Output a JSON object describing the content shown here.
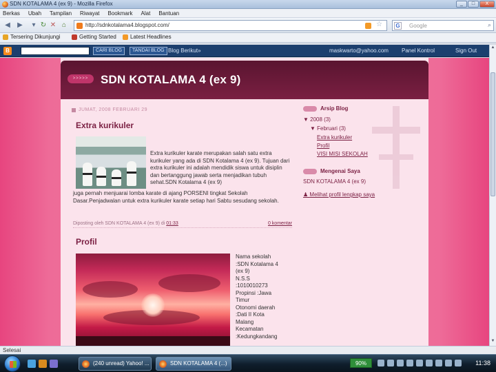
{
  "window": {
    "title": "SDN KOTALAMA 4 (ex 9) - Mozilla Firefox",
    "buttons": [
      "_",
      "□",
      "X"
    ]
  },
  "menu": [
    "Berkas",
    "Ubah",
    "Tampilan",
    "Riwayat",
    "Bookmark",
    "Alat",
    "Bantuan"
  ],
  "nav": {
    "url": "http://sdnkotalama4.blogspot.com/",
    "search_placeholder": "Google"
  },
  "bookmarks": [
    {
      "label": "Tersering Dikunjungi",
      "icon": "star-icon",
      "color": "#e7a526"
    },
    {
      "label": "Getting Started",
      "icon": "firefox-icon",
      "color": "#c0392b"
    },
    {
      "label": "Latest Headlines",
      "icon": "rss-icon",
      "color": "#f39a28"
    }
  ],
  "blogger_nav": {
    "search_button": "CARI BLOG",
    "flag_button": "TANDAI BLOG",
    "next_blog": "Blog Berikut»",
    "email": "maskwarto@yahoo.com",
    "dashboard": "Panel Kontrol",
    "signout": "Sign Out"
  },
  "blog": {
    "header_pill": ">>>>>",
    "title": "SDN KOTALAMA 4 (ex 9)",
    "date_header": "JUMAT, 2008 FEBRUARI 29",
    "posts": [
      {
        "title": "Extra kurikuler",
        "text_right": "Extra kurikuler karate merupakan salah satu extra kurikuler yang ada di SDN Kotalama 4 (ex 9). Tujuan dari extra kurikuler ini adalah mendidik siswa untuk disiplin dan bertanggung jawab serta menjadikan tubuh sehat.SDN Kotalama 4 (ex 9)",
        "text_full": "juga pernah menjuarai lomba karate di ajang PORSENI tingkat Sekolah Dasar.Penjadwalan untuk extra kurikuler karate setiap hari Sabtu sesudang sekolah.",
        "meta_posted": "Diposting oleh SDN KOTALAMA 4 (ex 9) di",
        "meta_time": "01:33",
        "meta_comments": "0 komentar"
      },
      {
        "title": "Profil",
        "profile_lines": [
          "Nama sekolah",
          ":SDN Kotalama 4",
          "(ex 9)",
          "N.S.S",
          ":1010010273",
          "Propinsi :Jawa",
          "Timur",
          "Otonomi daerah",
          ":Dati II Kota",
          "Malang",
          "Kecamatan",
          ":Kedungkandang"
        ]
      }
    ]
  },
  "sidebar": {
    "archive_title": "Arsip Blog",
    "archive_year": "▼ 2008 (3)",
    "archive_month": "▼ Februari (3)",
    "archive_posts": [
      "Extra kurikuler",
      "Profil",
      "VISI MISI SEKOLAH"
    ],
    "about_title": "Mengenai Saya",
    "about_name": "SDN KOTALAMA 4 (ex 9)",
    "profile_link": "Melihat profil lengkap saya"
  },
  "status": "Selesai",
  "taskbar": {
    "windows": [
      "(240 unread) Yahoo! ...",
      "SDN KOTALAMA 4 (...)"
    ],
    "battery": "90%",
    "clock": "11:38"
  }
}
